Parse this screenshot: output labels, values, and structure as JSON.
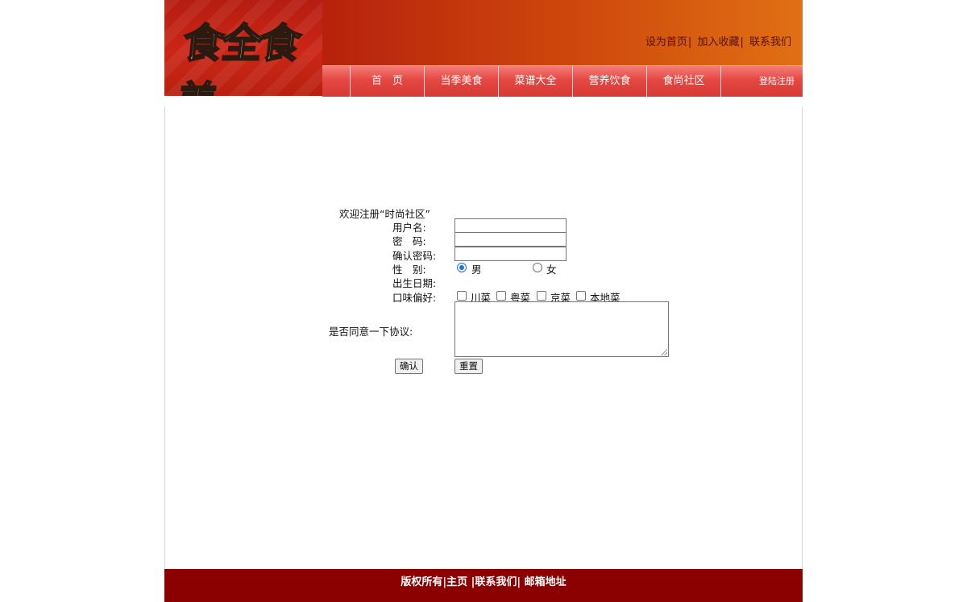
{
  "header": {
    "logo_text": "食全食美",
    "top_links": [
      {
        "label": "设为首页"
      },
      {
        "label": "加入收藏"
      },
      {
        "label": "联系我们"
      }
    ],
    "nav": [
      {
        "label": "首　页"
      },
      {
        "label": "当季美食"
      },
      {
        "label": "菜谱大全"
      },
      {
        "label": "营养饮食"
      },
      {
        "label": "食尚社区"
      }
    ],
    "login_label": "登陆注册"
  },
  "form": {
    "welcome": "欢迎注册“时尚社区”",
    "username_label": "用户名:",
    "password_label": "密　码:",
    "confirm_label": "确认密码:",
    "gender_label": "性　别:",
    "gender_male": "男",
    "gender_female": "女",
    "gender_selected": "男",
    "birthday_label": "出生日期:",
    "taste_label": "口味偏好:",
    "tastes": [
      {
        "label": "川菜"
      },
      {
        "label": "粤菜"
      },
      {
        "label": "京菜"
      },
      {
        "label": "本地菜"
      }
    ],
    "agreement_label": "是否同意一下协议:",
    "confirm_button": "确认",
    "reset_button": "重置"
  },
  "footer": {
    "text": "版权所有|主页 |联系我们| 邮箱地址"
  }
}
